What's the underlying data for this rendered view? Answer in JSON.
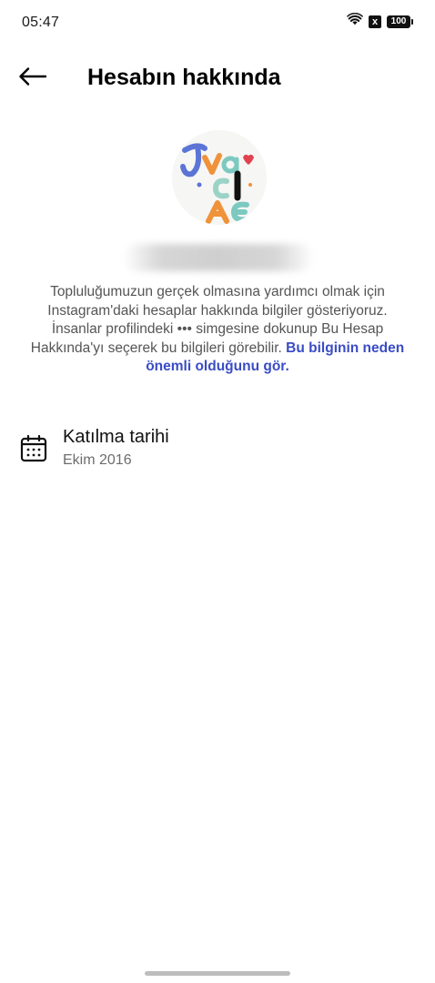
{
  "status_bar": {
    "time": "05:47",
    "battery_level": "100",
    "sim_status": "x",
    "icons": [
      "wifi-icon",
      "sim-off-icon",
      "battery-icon"
    ]
  },
  "header": {
    "title": "Hesabın hakkında",
    "back_icon": "back-arrow-icon"
  },
  "profile": {
    "avatar_icon": "profile-avatar",
    "avatar_letters": [
      "J",
      "v",
      "a",
      "C",
      "I",
      "A",
      "E"
    ]
  },
  "info": {
    "description": "Topluluğumuzun gerçek olmasına yardımcı olmak için Instagram'daki hesaplar hakkında bilgiler gösteriyoruz. İnsanlar profilindeki ••• simgesine dokunup Bu Hesap Hakkında'yı seçerek bu bilgileri görebilir.",
    "link": "Bu bilginin neden önemli olduğunu gör."
  },
  "join_date": {
    "icon": "calendar-icon",
    "label": "Katılma tarihi",
    "value": "Ekim 2016"
  },
  "colors": {
    "link": "#3a4cc4",
    "text_secondary": "#555555",
    "avatar_blue": "#5b74d6",
    "avatar_orange": "#f0923a",
    "avatar_teal": "#7cc9c0",
    "avatar_red": "#e0434f"
  }
}
